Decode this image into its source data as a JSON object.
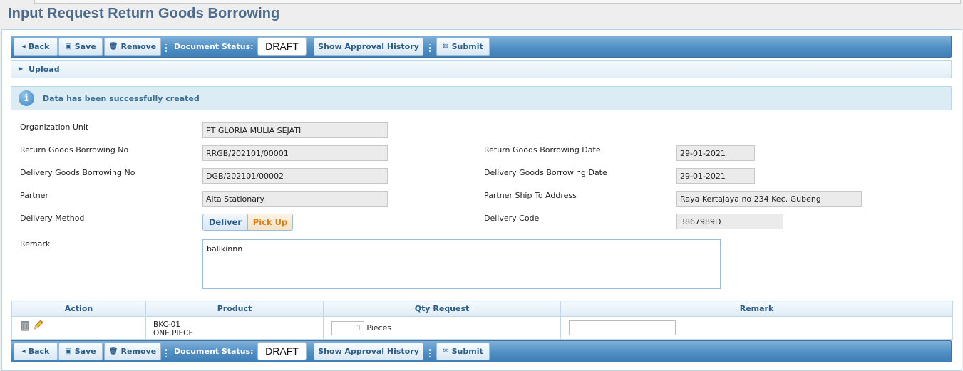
{
  "page": {
    "title": "Input Request Return Goods Borrowing"
  },
  "toolbar": {
    "back": "Back",
    "save": "Save",
    "remove": "Remove",
    "status_label": "Document Status:",
    "status_value": "DRAFT",
    "approval": "Show Approval History",
    "submit": "Submit"
  },
  "upload": {
    "label": "Upload"
  },
  "message": {
    "text": "Data has been successfully created"
  },
  "form": {
    "org_unit_label": "Organization Unit",
    "org_unit_value": "PT GLORIA MULIA SEJATI",
    "return_no_label": "Return Goods Borrowing No",
    "return_no_value": "RRGB/202101/00001",
    "return_date_label": "Return Goods Borrowing Date",
    "return_date_value": "29-01-2021",
    "delivery_no_label": "Delivery Goods Borrowing No",
    "delivery_no_value": "DGB/202101/00002",
    "delivery_date_label": "Delivery Goods Borrowing Date",
    "delivery_date_value": "29-01-2021",
    "partner_label": "Partner",
    "partner_value": "Alta Stationary",
    "ship_to_label": "Partner Ship To Address",
    "ship_to_value": "Raya Kertajaya no 234 Kec. Gubeng",
    "delivery_method_label": "Delivery Method",
    "delivery_method_options": [
      "Deliver",
      "Pick Up"
    ],
    "delivery_method_selected": "Pick Up",
    "delivery_code_label": "Delivery Code",
    "delivery_code_value": "3867989D",
    "remark_label": "Remark",
    "remark_value": "balikinnn"
  },
  "grid": {
    "columns": [
      "Action",
      "Product",
      "Qty Request",
      "Remark"
    ],
    "rows": [
      {
        "product_code": "BKC-01",
        "product_name": "ONE PIECE",
        "qty": "1",
        "unit": "Pieces",
        "remark": ""
      }
    ]
  },
  "icons": {
    "back": "caret-left-icon",
    "save": "floppy-icon",
    "remove": "trash-icon",
    "submit": "envelope-icon",
    "upload": "caret-right-icon",
    "info": "info-icon",
    "delete_row": "trash-can-icon",
    "edit_row": "pencil-icon"
  },
  "colors": {
    "title": "#4a6a8e",
    "toolbar": "#4f8fc4",
    "button_text": "#2b5d8c",
    "selected_option": "#e07f10",
    "info_bg": "#dbecf5"
  }
}
